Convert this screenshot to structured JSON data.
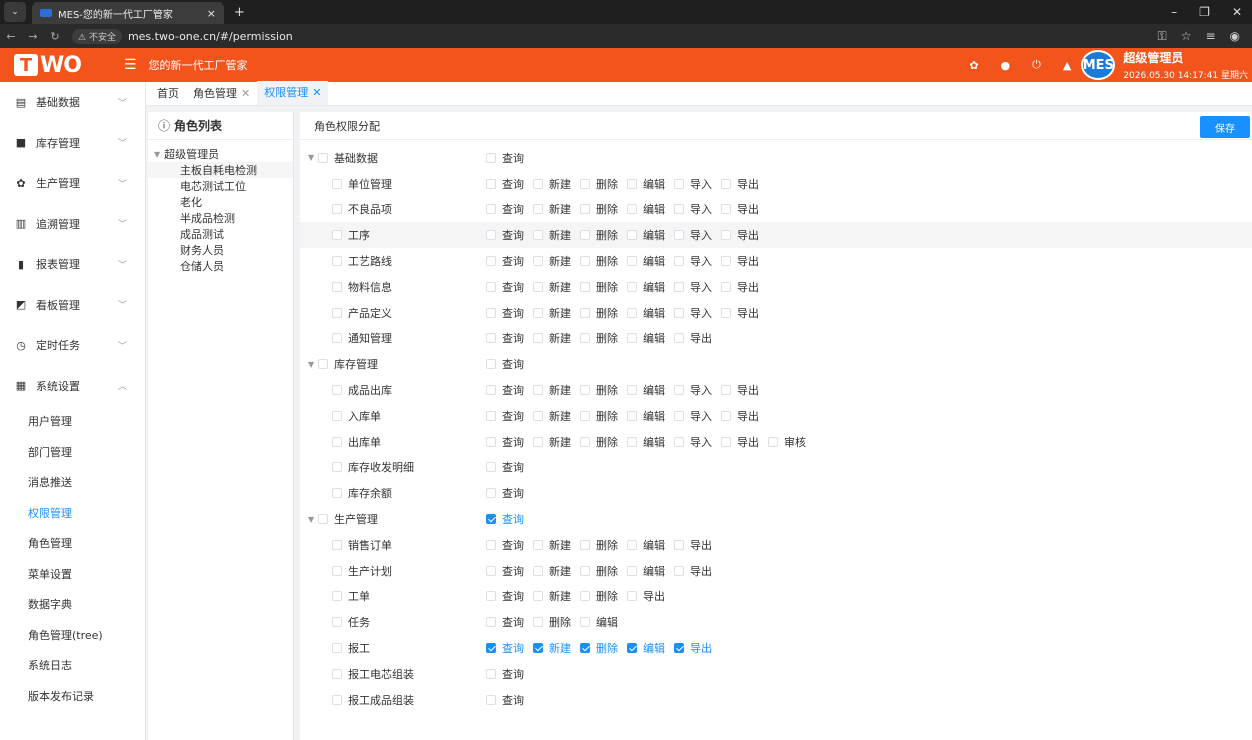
{
  "browser": {
    "tab_title": "MES-您的新一代工厂管家",
    "tab_close": "×",
    "new_tab": "+",
    "insecure_label": "不安全",
    "url": "mes.two-one.cn/#/permission"
  },
  "header": {
    "logo_t": "T",
    "logo_wo": "WO",
    "app_title": "您的新一代工厂管家",
    "avatar_text": "MES",
    "user_name": "超级管理员",
    "datetime": "2026.05.30 14:17:41 星期六"
  },
  "sidebar": {
    "groups": [
      {
        "label": "基础数据",
        "icon": "document-icon"
      },
      {
        "label": "库存管理",
        "icon": "inventory-icon"
      },
      {
        "label": "生产管理",
        "icon": "gear-icon"
      },
      {
        "label": "追溯管理",
        "icon": "trace-icon"
      },
      {
        "label": "报表管理",
        "icon": "bar-chart-icon"
      },
      {
        "label": "看板管理",
        "icon": "dashboard-icon"
      },
      {
        "label": "定时任务",
        "icon": "clock-icon"
      },
      {
        "label": "系统设置",
        "icon": "grid-icon"
      }
    ],
    "items": [
      "用户管理",
      "部门管理",
      "消息推送",
      "权限管理",
      "角色管理",
      "菜单设置",
      "数据字典",
      "角色管理(tree)",
      "系统日志",
      "版本发布记录"
    ]
  },
  "tags": [
    {
      "label": "首页"
    },
    {
      "label": "角色管理"
    },
    {
      "label": "权限管理"
    }
  ],
  "role_panel": {
    "title": "角色列表",
    "root": "超级管理员",
    "children": [
      "主板自耗电检测",
      "电芯测试工位",
      "老化",
      "半成品检测",
      "成品测试",
      "财务人员",
      "仓储人员"
    ]
  },
  "perm_panel": {
    "title": "角色权限分配",
    "save": "保存",
    "rows": [
      {
        "name": "基础数据",
        "level": 0,
        "perms": [
          [
            "查询",
            false
          ]
        ]
      },
      {
        "name": "单位管理",
        "level": 1,
        "perms": [
          [
            "查询",
            false
          ],
          [
            "新建",
            false
          ],
          [
            "删除",
            false
          ],
          [
            "编辑",
            false
          ],
          [
            "导入",
            false
          ],
          [
            "导出",
            false
          ]
        ]
      },
      {
        "name": "不良品项",
        "level": 1,
        "perms": [
          [
            "查询",
            false
          ],
          [
            "新建",
            false
          ],
          [
            "删除",
            false
          ],
          [
            "编辑",
            false
          ],
          [
            "导入",
            false
          ],
          [
            "导出",
            false
          ]
        ]
      },
      {
        "name": "工序",
        "level": 1,
        "perms": [
          [
            "查询",
            false
          ],
          [
            "新建",
            false
          ],
          [
            "删除",
            false
          ],
          [
            "编辑",
            false
          ],
          [
            "导入",
            false
          ],
          [
            "导出",
            false
          ]
        ]
      },
      {
        "name": "工艺路线",
        "level": 1,
        "perms": [
          [
            "查询",
            false
          ],
          [
            "新建",
            false
          ],
          [
            "删除",
            false
          ],
          [
            "编辑",
            false
          ],
          [
            "导入",
            false
          ],
          [
            "导出",
            false
          ]
        ]
      },
      {
        "name": "物料信息",
        "level": 1,
        "perms": [
          [
            "查询",
            false
          ],
          [
            "新建",
            false
          ],
          [
            "删除",
            false
          ],
          [
            "编辑",
            false
          ],
          [
            "导入",
            false
          ],
          [
            "导出",
            false
          ]
        ]
      },
      {
        "name": "产品定义",
        "level": 1,
        "perms": [
          [
            "查询",
            false
          ],
          [
            "新建",
            false
          ],
          [
            "删除",
            false
          ],
          [
            "编辑",
            false
          ],
          [
            "导入",
            false
          ],
          [
            "导出",
            false
          ]
        ]
      },
      {
        "name": "通知管理",
        "level": 1,
        "perms": [
          [
            "查询",
            false
          ],
          [
            "新建",
            false
          ],
          [
            "删除",
            false
          ],
          [
            "编辑",
            false
          ],
          [
            "导出",
            false
          ]
        ]
      },
      {
        "name": "库存管理",
        "level": 0,
        "perms": [
          [
            "查询",
            false
          ]
        ]
      },
      {
        "name": "成品出库",
        "level": 1,
        "perms": [
          [
            "查询",
            false
          ],
          [
            "新建",
            false
          ],
          [
            "删除",
            false
          ],
          [
            "编辑",
            false
          ],
          [
            "导入",
            false
          ],
          [
            "导出",
            false
          ]
        ]
      },
      {
        "name": "入库单",
        "level": 1,
        "perms": [
          [
            "查询",
            false
          ],
          [
            "新建",
            false
          ],
          [
            "删除",
            false
          ],
          [
            "编辑",
            false
          ],
          [
            "导入",
            false
          ],
          [
            "导出",
            false
          ]
        ]
      },
      {
        "name": "出库单",
        "level": 1,
        "perms": [
          [
            "查询",
            false
          ],
          [
            "新建",
            false
          ],
          [
            "删除",
            false
          ],
          [
            "编辑",
            false
          ],
          [
            "导入",
            false
          ],
          [
            "导出",
            false
          ],
          [
            "审核",
            false
          ]
        ]
      },
      {
        "name": "库存收发明细",
        "level": 1,
        "perms": [
          [
            "查询",
            false
          ]
        ]
      },
      {
        "name": "库存余额",
        "level": 1,
        "perms": [
          [
            "查询",
            false
          ]
        ]
      },
      {
        "name": "生产管理",
        "level": 0,
        "perms": [
          [
            "查询",
            true
          ]
        ]
      },
      {
        "name": "销售订单",
        "level": 1,
        "perms": [
          [
            "查询",
            false
          ],
          [
            "新建",
            false
          ],
          [
            "删除",
            false
          ],
          [
            "编辑",
            false
          ],
          [
            "导出",
            false
          ]
        ]
      },
      {
        "name": "生产计划",
        "level": 1,
        "perms": [
          [
            "查询",
            false
          ],
          [
            "新建",
            false
          ],
          [
            "删除",
            false
          ],
          [
            "编辑",
            false
          ],
          [
            "导出",
            false
          ]
        ]
      },
      {
        "name": "工单",
        "level": 1,
        "perms": [
          [
            "查询",
            false
          ],
          [
            "新建",
            false
          ],
          [
            "删除",
            false
          ],
          [
            "导出",
            false
          ]
        ]
      },
      {
        "name": "任务",
        "level": 1,
        "perms": [
          [
            "查询",
            false
          ],
          [
            "删除",
            false
          ],
          [
            "编辑",
            false
          ]
        ]
      },
      {
        "name": "报工",
        "level": 1,
        "perms": [
          [
            "查询",
            true
          ],
          [
            "新建",
            true
          ],
          [
            "删除",
            true
          ],
          [
            "编辑",
            true
          ],
          [
            "导出",
            true
          ]
        ]
      },
      {
        "name": "报工电芯组装",
        "level": 1,
        "perms": [
          [
            "查询",
            false
          ]
        ]
      },
      {
        "name": "报工成品组装",
        "level": 1,
        "perms": [
          [
            "查询",
            false
          ]
        ]
      }
    ]
  },
  "colors": {
    "brand": "#f3541b",
    "accent": "#1890ff"
  }
}
